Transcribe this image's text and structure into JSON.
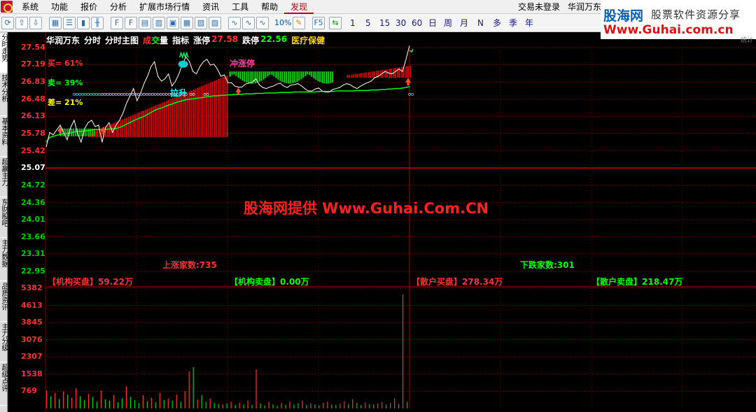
{
  "menu": {
    "items": [
      "系统",
      "功能",
      "报价",
      "分析",
      "扩展市场行情",
      "资讯",
      "工具",
      "帮助",
      "发现"
    ],
    "active": "发现",
    "login_status": "交易未登录",
    "stock_name": "华润万东"
  },
  "toolbar": {
    "period_labels": [
      "10%",
      "1",
      "5",
      "15",
      "30",
      "60",
      "日",
      "周",
      "月",
      "N",
      "多",
      "季",
      "年"
    ]
  },
  "watermark": {
    "brand": "股海网",
    "slogan": "股票软件资源分享",
    "url": "Www.Guhai.com.cn",
    "corner": "统计",
    "center": "股海网提供 Www.Guhai.Com.CN"
  },
  "side_tabs": [
    "分时走势",
    "技术分析",
    "基本资料",
    "超赢主力",
    "东财股吧",
    "主力数据",
    "品质资讯",
    "主力分级",
    "超级点评"
  ],
  "chart_header": {
    "stock": "华润万东",
    "mode": "分时",
    "main": "分时主图",
    "vol_red": "成",
    "vol_green": "交",
    "vol_white": "量",
    "indicator": "指标",
    "limit_up_label": "涨停",
    "limit_up_value": "27.58",
    "limit_down_label": "跌停",
    "limit_down_value": "22.56",
    "sector": "医疗保健"
  },
  "overlay": {
    "buy": "买= 61%",
    "sell": "卖= 39%",
    "diff": "差= 21%",
    "lift": "拉升",
    "limit_tag": "冲涨停",
    "rise_count": "上涨家数:735",
    "fall_count": "下跌家数:301",
    "inst_buy": "【机构买盘】59.22万",
    "inst_sell": "【机构卖盘】0.00万",
    "retail_buy": "【散户买盘】278.34万",
    "retail_sell": "【散户卖盘】218.47万"
  },
  "colors": {
    "up": "#ff3030",
    "down": "#00ff00",
    "base": "#ffffff",
    "price_line": "#ffffff",
    "avg_line": "#00ff00",
    "grid": "#800000"
  },
  "chart_data": [
    {
      "type": "line",
      "name": "price",
      "y_ticks": [
        "27.54",
        "27.19",
        "26.83",
        "26.48",
        "26.13",
        "25.78",
        "25.42",
        "25.07",
        "24.72",
        "24.36",
        "24.01",
        "23.66",
        "23.31",
        "22.95"
      ],
      "ylim": [
        22.95,
        27.54
      ],
      "base_price": 25.07,
      "x": [
        0,
        5,
        10,
        15,
        20,
        25,
        30,
        35,
        40,
        45,
        50,
        55,
        60,
        65,
        70,
        75,
        80,
        85,
        90,
        95,
        100,
        105,
        110,
        115,
        120,
        125,
        130,
        135,
        140,
        145,
        150,
        155,
        160,
        165,
        170,
        175,
        180,
        185,
        190,
        195,
        200,
        205,
        210,
        215,
        220,
        225,
        230,
        235,
        240,
        245,
        250,
        255,
        260,
        265,
        270,
        275,
        280,
        285,
        290,
        295,
        300,
        305,
        310,
        315,
        320,
        325,
        330,
        335,
        340,
        345,
        350,
        355,
        360,
        365,
        370,
        375,
        380,
        385,
        390,
        395,
        400,
        405,
        410,
        415,
        420,
        425,
        430,
        435,
        440,
        445,
        450,
        455,
        460,
        465,
        470,
        475,
        480,
        485,
        490,
        495,
        500,
        505,
        510,
        515,
        520
      ],
      "price": [
        25.5,
        25.8,
        25.75,
        25.85,
        25.95,
        25.8,
        25.65,
        25.9,
        26.05,
        25.78,
        25.6,
        25.88,
        26.0,
        26.05,
        25.92,
        25.95,
        25.6,
        25.9,
        26.0,
        25.8,
        25.95,
        26.05,
        26.2,
        26.4,
        26.55,
        26.7,
        26.45,
        26.6,
        26.8,
        26.95,
        27.15,
        27.25,
        26.95,
        26.85,
        26.9,
        27.0,
        26.75,
        26.85,
        27.0,
        27.2,
        27.35,
        27.25,
        27.05,
        27.0,
        27.15,
        27.25,
        27.3,
        27.18,
        27.2,
        27.1,
        26.95,
        26.98,
        26.82,
        26.82,
        26.75,
        26.73,
        26.73,
        26.79,
        26.81,
        26.83,
        26.9,
        26.78,
        26.72,
        26.7,
        26.73,
        26.75,
        26.79,
        26.81,
        26.75,
        26.72,
        26.77,
        26.78,
        26.8,
        26.76,
        26.7,
        26.65,
        26.65,
        26.69,
        26.71,
        26.65,
        26.63,
        26.63,
        26.68,
        26.7,
        26.72,
        26.77,
        26.8,
        26.78,
        26.73,
        26.7,
        26.75,
        26.79,
        26.82,
        26.85,
        26.92,
        26.95,
        27.0,
        27.05,
        27.02,
        27.0,
        27.05,
        27.1,
        27.05,
        27.3,
        27.58
      ],
      "avg": [
        25.6,
        25.7,
        25.72,
        25.74,
        25.76,
        25.77,
        25.78,
        25.79,
        25.81,
        25.82,
        25.82,
        25.83,
        25.84,
        25.85,
        25.86,
        25.86,
        25.86,
        25.86,
        25.87,
        25.87,
        25.88,
        25.9,
        25.93,
        25.97,
        26.0,
        26.04,
        26.07,
        26.1,
        26.13,
        26.17,
        26.21,
        26.25,
        26.28,
        26.3,
        26.33,
        26.36,
        26.38,
        26.41,
        26.43,
        26.45,
        26.47,
        26.48,
        26.49,
        26.5,
        26.51,
        26.52,
        26.53,
        26.54,
        26.55,
        26.55,
        26.56,
        26.56,
        26.57,
        26.57,
        26.58,
        26.58,
        26.58,
        26.59,
        26.59,
        26.59,
        26.6,
        26.6,
        26.6,
        26.61,
        26.61,
        26.61,
        26.61,
        26.62,
        26.62,
        26.62,
        26.62,
        26.63,
        26.63,
        26.63,
        26.63,
        26.63,
        26.63,
        26.63,
        26.64,
        26.64,
        26.64,
        26.64,
        26.64,
        26.65,
        26.65,
        26.65,
        26.65,
        26.65,
        26.65,
        26.66,
        26.66,
        26.66,
        26.66,
        26.67,
        26.67,
        26.67,
        26.68,
        26.68,
        26.69,
        26.69,
        26.7,
        26.7,
        26.71,
        26.72,
        26.74
      ]
    },
    {
      "type": "bar",
      "name": "volume",
      "y_ticks": [
        "5382",
        "4613",
        "3845",
        "3076",
        "2307",
        "1538",
        "769"
      ],
      "ylim": [
        0,
        5382
      ],
      "x": [
        0,
        6,
        12,
        18,
        24,
        30,
        36,
        42,
        48,
        54,
        60,
        66,
        72,
        78,
        84,
        90,
        96,
        102,
        108,
        114,
        120,
        126,
        132,
        138,
        144,
        150,
        156,
        162,
        168,
        174,
        180,
        186,
        192,
        198,
        204,
        210,
        216,
        222,
        228,
        234,
        240,
        246,
        252,
        258,
        264,
        270,
        276,
        282,
        288,
        294,
        300,
        306,
        312,
        318,
        324,
        330,
        336,
        342,
        348,
        354,
        360,
        366,
        372,
        378,
        384,
        390,
        396,
        402,
        408,
        414,
        420,
        426,
        432,
        438,
        444,
        450,
        456,
        462,
        468,
        474,
        480,
        486,
        492,
        498,
        504,
        510,
        516
      ],
      "values": [
        800,
        550,
        700,
        420,
        760,
        620,
        480,
        900,
        550,
        380,
        650,
        520,
        300,
        800,
        410,
        350,
        600,
        280,
        450,
        990,
        520,
        380,
        250,
        600,
        320,
        480,
        280,
        700,
        380,
        450,
        350,
        620,
        300,
        780,
        1650,
        1850,
        400,
        600,
        300,
        450,
        250,
        200,
        180,
        220,
        300,
        160,
        260,
        180,
        350,
        160,
        1750,
        220,
        140,
        300,
        180,
        120,
        250,
        160,
        300,
        180,
        240,
        350,
        160,
        220,
        180,
        140,
        260,
        300,
        180,
        160,
        220,
        330,
        200,
        420,
        260,
        160,
        280,
        200,
        180,
        220,
        300,
        180,
        250,
        450,
        200,
        5100,
        300
      ],
      "up_flags": [
        1,
        0,
        1,
        0,
        1,
        0,
        1,
        1,
        0,
        0,
        1,
        0,
        0,
        1,
        0,
        0,
        1,
        0,
        0,
        1,
        0,
        0,
        0,
        1,
        0,
        1,
        0,
        1,
        0,
        1,
        0,
        1,
        0,
        1,
        1,
        0,
        1,
        0,
        0,
        1,
        0,
        0,
        1,
        0,
        1,
        0,
        1,
        0,
        1,
        0,
        1,
        0,
        0,
        1,
        0,
        0,
        1,
        0,
        1,
        0,
        0,
        1,
        0,
        1,
        0,
        0,
        1,
        1,
        0,
        0,
        1,
        1,
        0,
        1,
        0,
        0,
        1,
        0,
        0,
        1,
        1,
        0,
        1,
        1,
        0,
        1,
        0
      ]
    }
  ]
}
